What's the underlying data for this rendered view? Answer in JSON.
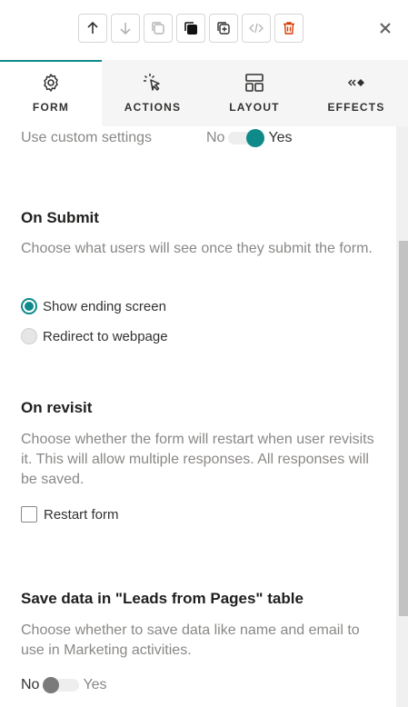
{
  "toolbar": {
    "buttons": [
      {
        "icon": "arrow-up-icon"
      },
      {
        "icon": "arrow-down-icon"
      },
      {
        "icon": "copy-icon"
      },
      {
        "icon": "bring-to-front-icon"
      },
      {
        "icon": "duplicate-icon"
      },
      {
        "icon": "code-icon"
      },
      {
        "icon": "delete-icon"
      }
    ],
    "close_icon": "close-icon",
    "colors": {
      "delete": "#d83b01",
      "disabled": "#b3b3b3",
      "enabled": "#323130"
    }
  },
  "tabs": [
    {
      "label": "FORM",
      "icon": "gear-icon",
      "active": true
    },
    {
      "label": "ACTIONS",
      "icon": "cursor-click-icon",
      "active": false
    },
    {
      "label": "LAYOUT",
      "icon": "layout-icon",
      "active": false
    },
    {
      "label": "EFFECTS",
      "icon": "effects-icon",
      "active": false
    }
  ],
  "custom_settings": {
    "label": "Use custom settings",
    "off_label": "No",
    "on_label": "Yes",
    "value": true
  },
  "on_submit": {
    "heading": "On Submit",
    "description": "Choose what users will see once they submit the form.",
    "options": [
      "Show ending screen",
      "Redirect to webpage"
    ],
    "selected": "Show ending screen"
  },
  "on_revisit": {
    "heading": "On revisit",
    "description": "Choose whether the form will restart when user revisits it. This will allow multiple responses. All responses will be saved.",
    "checkbox_label": "Restart form",
    "checked": false
  },
  "save_data": {
    "heading": "Save data in \"Leads from Pages\" table",
    "description": "Choose whether to save data like name and email to use in Marketing activities.",
    "off_label": "No",
    "on_label": "Yes",
    "value": false
  },
  "accent_color": "#0f8a8a"
}
